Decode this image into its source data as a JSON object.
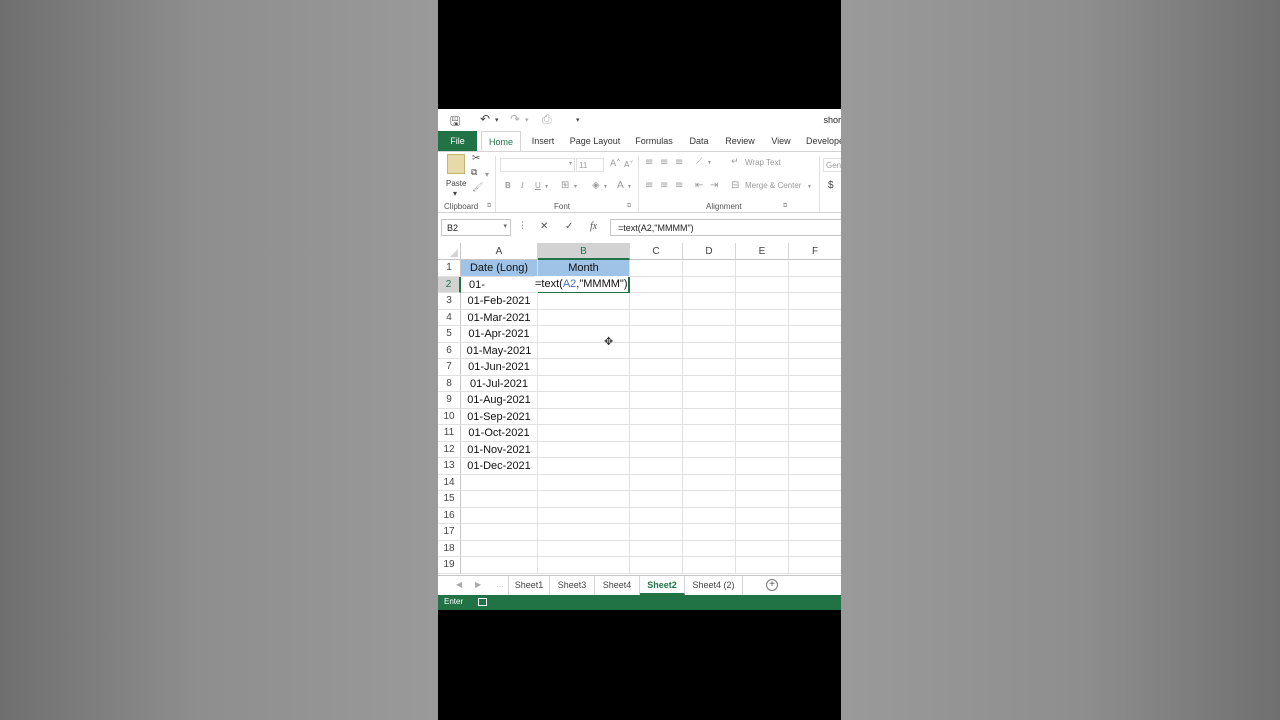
{
  "window": {
    "title_fragment": "shor"
  },
  "ribbon_tabs": [
    "File",
    "Home",
    "Insert",
    "Page Layout",
    "Formulas",
    "Data",
    "Review",
    "View",
    "Develope"
  ],
  "active_tab": "Home",
  "ribbon": {
    "paste_label": "Paste",
    "font_size": "11",
    "wrap_text": "Wrap Text",
    "merge_center": "Merge & Center",
    "number_format_fragment": "Gen",
    "currency_symbol": "$",
    "groups": {
      "clipboard": "Clipboard",
      "font": "Font",
      "alignment": "Alignment"
    },
    "bold": "B",
    "italic": "I",
    "underline": "U"
  },
  "formula_bar": {
    "name_box": "B2",
    "cancel_icon": "✕",
    "enter_icon": "✓",
    "fx_label": "fx",
    "formula": "=text(A2,\"MMMM\")"
  },
  "columns": [
    "A",
    "B",
    "C",
    "D",
    "E",
    "F"
  ],
  "rows": [
    "1",
    "2",
    "3",
    "4",
    "5",
    "6",
    "7",
    "8",
    "9",
    "10",
    "11",
    "12",
    "13",
    "14",
    "15",
    "16",
    "17",
    "18",
    "19"
  ],
  "cells": {
    "A1": "Date (Long)",
    "B1": "Month",
    "A2": "01-",
    "A3": "01-Feb-2021",
    "A4": "01-Mar-2021",
    "A5": "01-Apr-2021",
    "A6": "01-May-2021",
    "A7": "01-Jun-2021",
    "A8": "01-Jul-2021",
    "A9": "01-Aug-2021",
    "A10": "01-Sep-2021",
    "A11": "01-Oct-2021",
    "A12": "01-Nov-2021",
    "A13": "01-Dec-2021"
  },
  "editing_formula": {
    "prefix": "=text(",
    "ref": "A2",
    "suffix": ",\"MMMM\")"
  },
  "sheets": [
    "Sheet1",
    "Sheet3",
    "Sheet4",
    "Sheet2",
    "Sheet4 (2)"
  ],
  "active_sheet": "Sheet2",
  "status": {
    "mode": "Enter"
  },
  "colors": {
    "excel_green": "#217346",
    "header_fill": "#9ec3e6",
    "ref_blue": "#4472c4"
  }
}
